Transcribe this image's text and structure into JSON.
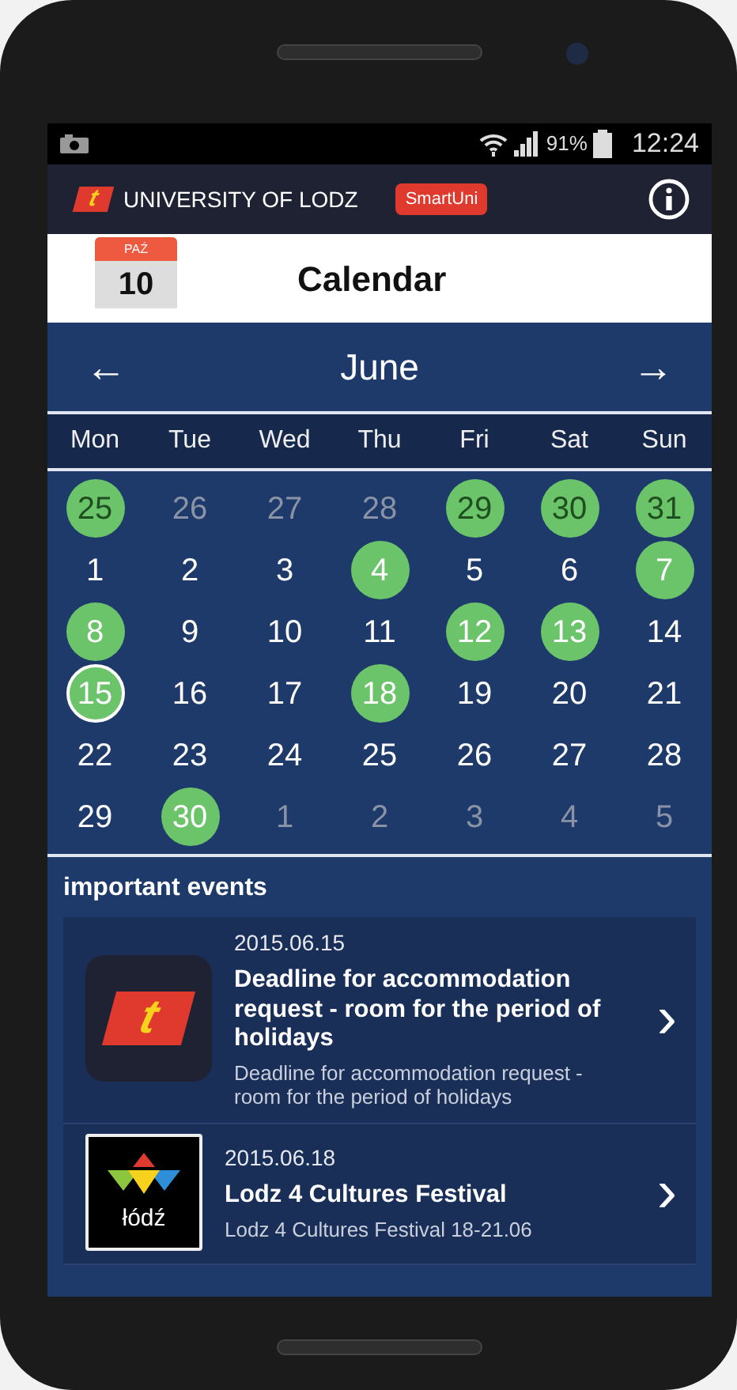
{
  "status_bar": {
    "battery": "91%",
    "time": "12:24"
  },
  "app_header": {
    "logo_letter": "t",
    "university": "UNIVERSITY OF LODZ",
    "badge": "SmartUni"
  },
  "title_bar": {
    "icon_month": "PAŹ",
    "icon_day": "10",
    "title": "Calendar"
  },
  "month_nav": {
    "prev": "←",
    "month": "June",
    "next": "→"
  },
  "weekdays": [
    "Mon",
    "Tue",
    "Wed",
    "Thu",
    "Fri",
    "Sat",
    "Sun"
  ],
  "days": [
    {
      "label": "25",
      "muted": true,
      "event": true,
      "selected": false
    },
    {
      "label": "26",
      "muted": true,
      "event": false,
      "selected": false
    },
    {
      "label": "27",
      "muted": true,
      "event": false,
      "selected": false
    },
    {
      "label": "28",
      "muted": true,
      "event": false,
      "selected": false
    },
    {
      "label": "29",
      "muted": true,
      "event": true,
      "selected": false
    },
    {
      "label": "30",
      "muted": true,
      "event": true,
      "selected": false
    },
    {
      "label": "31",
      "muted": true,
      "event": true,
      "selected": false
    },
    {
      "label": "1",
      "muted": false,
      "event": false,
      "selected": false
    },
    {
      "label": "2",
      "muted": false,
      "event": false,
      "selected": false
    },
    {
      "label": "3",
      "muted": false,
      "event": false,
      "selected": false
    },
    {
      "label": "4",
      "muted": false,
      "event": true,
      "selected": false
    },
    {
      "label": "5",
      "muted": false,
      "event": false,
      "selected": false
    },
    {
      "label": "6",
      "muted": false,
      "event": false,
      "selected": false
    },
    {
      "label": "7",
      "muted": false,
      "event": true,
      "selected": false
    },
    {
      "label": "8",
      "muted": false,
      "event": true,
      "selected": false
    },
    {
      "label": "9",
      "muted": false,
      "event": false,
      "selected": false
    },
    {
      "label": "10",
      "muted": false,
      "event": false,
      "selected": false
    },
    {
      "label": "11",
      "muted": false,
      "event": false,
      "selected": false
    },
    {
      "label": "12",
      "muted": false,
      "event": true,
      "selected": false
    },
    {
      "label": "13",
      "muted": false,
      "event": true,
      "selected": false
    },
    {
      "label": "14",
      "muted": false,
      "event": false,
      "selected": false
    },
    {
      "label": "15",
      "muted": false,
      "event": true,
      "selected": true
    },
    {
      "label": "16",
      "muted": false,
      "event": false,
      "selected": false
    },
    {
      "label": "17",
      "muted": false,
      "event": false,
      "selected": false
    },
    {
      "label": "18",
      "muted": false,
      "event": true,
      "selected": false
    },
    {
      "label": "19",
      "muted": false,
      "event": false,
      "selected": false
    },
    {
      "label": "20",
      "muted": false,
      "event": false,
      "selected": false
    },
    {
      "label": "21",
      "muted": false,
      "event": false,
      "selected": false
    },
    {
      "label": "22",
      "muted": false,
      "event": false,
      "selected": false
    },
    {
      "label": "23",
      "muted": false,
      "event": false,
      "selected": false
    },
    {
      "label": "24",
      "muted": false,
      "event": false,
      "selected": false
    },
    {
      "label": "25",
      "muted": false,
      "event": false,
      "selected": false
    },
    {
      "label": "26",
      "muted": false,
      "event": false,
      "selected": false
    },
    {
      "label": "27",
      "muted": false,
      "event": false,
      "selected": false
    },
    {
      "label": "28",
      "muted": false,
      "event": false,
      "selected": false
    },
    {
      "label": "29",
      "muted": false,
      "event": false,
      "selected": false
    },
    {
      "label": "30",
      "muted": false,
      "event": true,
      "selected": false
    },
    {
      "label": "1",
      "muted": true,
      "event": false,
      "selected": false
    },
    {
      "label": "2",
      "muted": true,
      "event": false,
      "selected": false
    },
    {
      "label": "3",
      "muted": true,
      "event": false,
      "selected": false
    },
    {
      "label": "4",
      "muted": true,
      "event": false,
      "selected": false
    },
    {
      "label": "5",
      "muted": true,
      "event": false,
      "selected": false
    }
  ],
  "events_heading": "important events",
  "events": [
    {
      "kind": "university",
      "icon_text": "t",
      "date": "2015.06.15",
      "title": "Deadline for accommodation request - room for the period of holidays",
      "description": "Deadline for accommodation request - room for the period of holidays",
      "chevron": "›"
    },
    {
      "kind": "festival",
      "icon_text": "łódź",
      "date": "2015.06.18",
      "title": "Lodz 4 Cultures Festival",
      "description": "Lodz 4 Cultures Festival 18-21.06",
      "chevron": "›"
    }
  ]
}
